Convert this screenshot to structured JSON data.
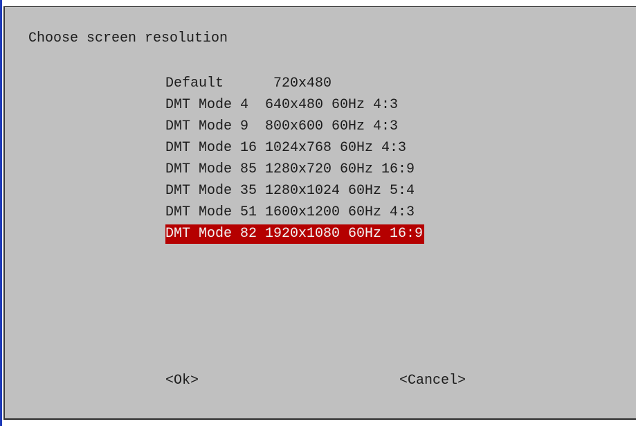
{
  "colors": {
    "background": "#c0c0c0",
    "selection_background": "#b50000",
    "selection_text": "#f2f2f2",
    "text": "#1c1c1c",
    "left_rail": "#1f3bb8"
  },
  "dialog": {
    "title": "Choose screen resolution",
    "options": [
      {
        "label": "Default      720x480",
        "selected": false
      },
      {
        "label": "DMT Mode 4  640x480 60Hz 4:3",
        "selected": false
      },
      {
        "label": "DMT Mode 9  800x600 60Hz 4:3",
        "selected": false
      },
      {
        "label": "DMT Mode 16 1024x768 60Hz 4:3",
        "selected": false
      },
      {
        "label": "DMT Mode 85 1280x720 60Hz 16:9",
        "selected": false
      },
      {
        "label": "DMT Mode 35 1280x1024 60Hz 5:4",
        "selected": false
      },
      {
        "label": "DMT Mode 51 1600x1200 60Hz 4:3",
        "selected": false
      },
      {
        "label": "DMT Mode 82 1920x1080 60Hz 16:9",
        "selected": true
      }
    ],
    "ok_label": "<Ok>",
    "cancel_label": "<Cancel>"
  }
}
